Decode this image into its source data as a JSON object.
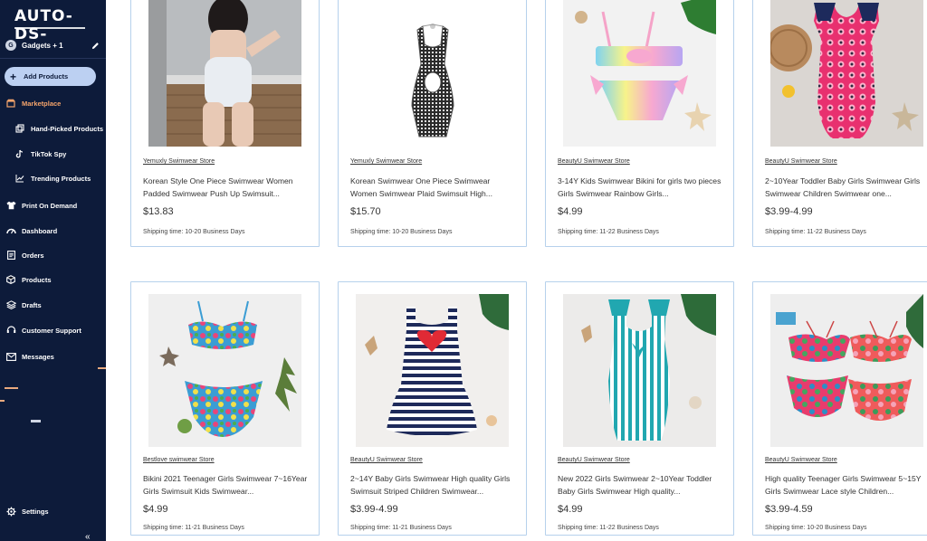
{
  "sidebar": {
    "logo": "AUTO-DS-",
    "store": {
      "avatar_letter": "G",
      "name": "Gadgets + 1"
    },
    "add_products": "Add Products",
    "items": [
      {
        "label": "Marketplace",
        "icon": "store-icon",
        "active": true
      },
      {
        "label": "Hand-Picked Products",
        "icon": "hand-picked-icon"
      },
      {
        "label": "TikTok Spy",
        "icon": "tiktok-icon"
      },
      {
        "label": "Trending Products",
        "icon": "trending-icon"
      },
      {
        "label": "Print On Demand",
        "icon": "print-icon"
      },
      {
        "label": "Dashboard",
        "icon": "dashboard-icon"
      },
      {
        "label": "Orders",
        "icon": "orders-icon"
      },
      {
        "label": "Products",
        "icon": "products-icon"
      },
      {
        "label": "Drafts",
        "icon": "drafts-icon"
      },
      {
        "label": "Customer Support",
        "icon": "support-icon"
      },
      {
        "label": "Messages",
        "icon": "messages-icon"
      },
      {
        "label": "Settings",
        "icon": "gear-icon"
      }
    ],
    "collapse": "«",
    "accent_color": "#f5a46b",
    "background_color": "#0d1b3a"
  },
  "products": [
    {
      "store": "Yemuxly Swimwear Store",
      "title": "Korean Style One Piece Swimwear Women Padded Swimwear Push Up Swimsuit...",
      "price": "$13.83",
      "shipping": "Shipping time: 10-20 Business Days"
    },
    {
      "store": "Yemuxly Swimwear Store",
      "title": "Korean Swimwear One Piece Swimwear Women Swimwear Plaid Swimsuit High...",
      "price": "$15.70",
      "shipping": "Shipping time: 10-20 Business Days"
    },
    {
      "store": "BeautyU Swimwear Store",
      "title": "3-14Y Kids Swimwear Bikini for girls two pieces Girls Swimwear Rainbow Girls...",
      "price": "$4.99",
      "shipping": "Shipping time: 11-22 Business Days"
    },
    {
      "store": "BeautyU Swimwear Store",
      "title": "2~10Year Toddler Baby Girls Swimwear Girls Swimwear Children Swimwear one...",
      "price": "$3.99-4.99",
      "shipping": "Shipping time: 11-22 Business Days"
    },
    {
      "store": "Bestlove swimwear Store",
      "title": "Bikini 2021 Teenager Girls Swimwear 7~16Year Girls Swimsuit Kids Swimwear...",
      "price": "$4.99",
      "shipping": "Shipping time: 11-21 Business Days"
    },
    {
      "store": "BeautyU Swimwear Store",
      "title": "2~14Y Baby Girls Swimwear High quality Girls Swimsuit Striped Children Swimwear...",
      "price": "$3.99-4.99",
      "shipping": "Shipping time: 11-21 Business Days"
    },
    {
      "store": "BeautyU Swimwear Store",
      "title": "New 2022 Girls Swimwear 2~10Year Toddler Baby Girls Swimwear High quality...",
      "price": "$4.99",
      "shipping": "Shipping time: 11-22 Business Days"
    },
    {
      "store": "BeautyU Swimwear Store",
      "title": "High quality Teenager Girls Swimwear 5~15Y Girls Swimwear Lace style Children...",
      "price": "$3.99-4.59",
      "shipping": "Shipping time: 10-20 Business Days"
    }
  ]
}
